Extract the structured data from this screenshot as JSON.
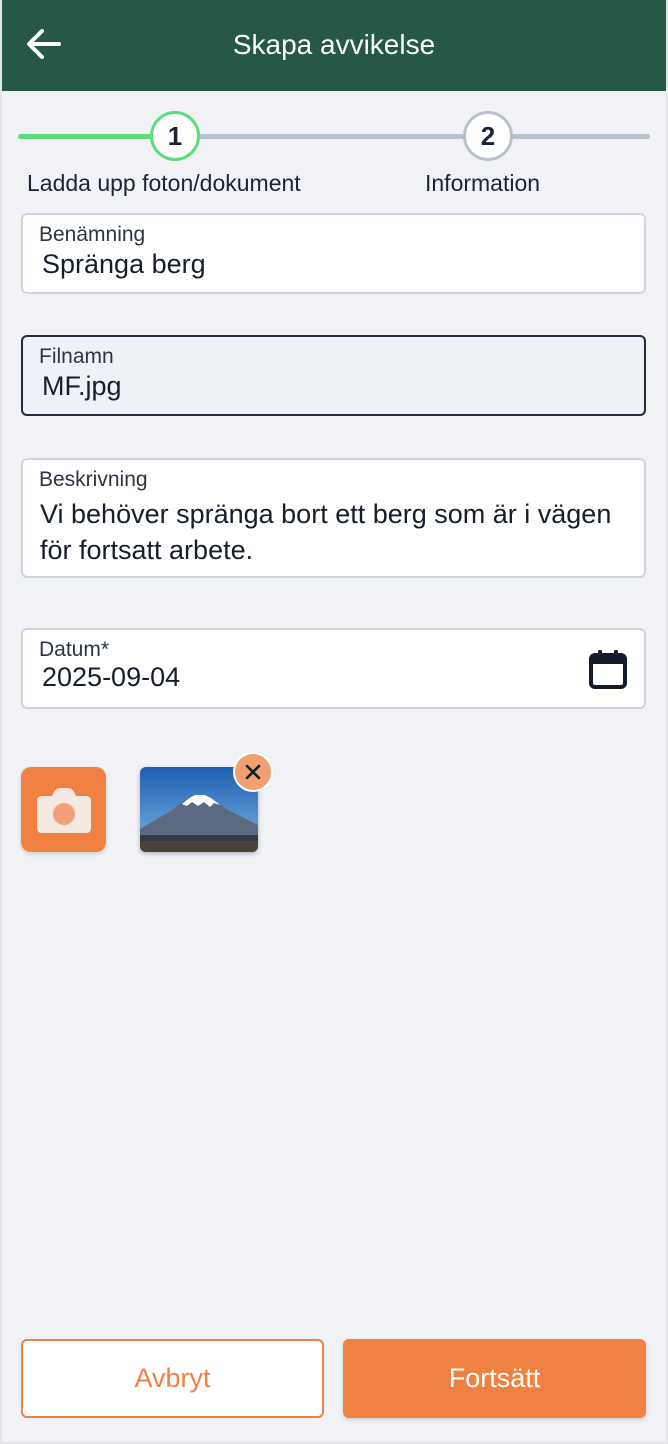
{
  "header": {
    "title": "Skapa avvikelse",
    "back_icon": "arrow-left-icon",
    "background": "#275846"
  },
  "stepper": {
    "steps": [
      {
        "number": "1",
        "label": "Ladda upp foton/dokument",
        "state": "active"
      },
      {
        "number": "2",
        "label": "Information",
        "state": "pending"
      }
    ],
    "active_color": "#5edc7d",
    "inactive_color": "#b9c2cb"
  },
  "form": {
    "name": {
      "label": "Benämning",
      "value": "Spränga berg"
    },
    "filename": {
      "label": "Filnamn",
      "value": "MF.jpg"
    },
    "description": {
      "label": "Beskrivning",
      "value": "Vi behöver spränga bort ett berg som är i vägen för fortsatt arbete."
    },
    "date": {
      "label": "Datum*",
      "value": "2025-09-04",
      "icon": "calendar-icon"
    }
  },
  "attachments": {
    "camera_icon": "camera-icon",
    "thumbnail_icon": "mountain-photo",
    "remove_icon": "close-icon"
  },
  "footer": {
    "cancel_label": "Avbryt",
    "continue_label": "Fortsätt"
  },
  "colors": {
    "accent": "#f08142",
    "background": "#f0f2f6"
  }
}
